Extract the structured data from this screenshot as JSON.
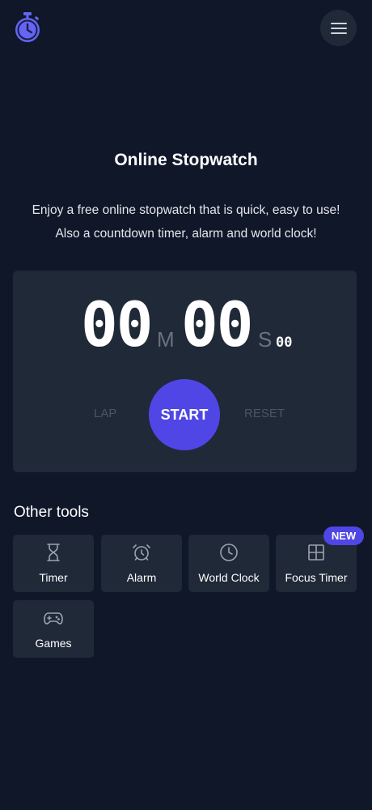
{
  "header": {
    "logo_icon": "stopwatch-icon",
    "menu_icon": "hamburger-menu-icon"
  },
  "hero": {
    "title": "Online Stopwatch",
    "subtitle_line1": "Enjoy a free online stopwatch that is quick, easy to use!",
    "subtitle_line2": "Also a countdown timer, alarm and world clock!"
  },
  "stopwatch": {
    "minutes": "00",
    "minutes_unit": "M",
    "seconds": "00",
    "seconds_unit": "S",
    "hundredths": "00",
    "lap_label": "LAP",
    "start_label": "START",
    "reset_label": "RESET"
  },
  "tools": {
    "section_title": "Other tools",
    "items": [
      {
        "label": "Timer",
        "icon": "hourglass-icon"
      },
      {
        "label": "Alarm",
        "icon": "alarm-clock-icon"
      },
      {
        "label": "World Clock",
        "icon": "clock-icon"
      },
      {
        "label": "Focus Timer",
        "icon": "grid-icon",
        "badge": "NEW"
      },
      {
        "label": "Games",
        "icon": "gamepad-icon"
      }
    ]
  },
  "colors": {
    "background": "#0f1729",
    "card": "#1f2937",
    "accent": "#4f46e5",
    "muted": "#6b7280"
  }
}
